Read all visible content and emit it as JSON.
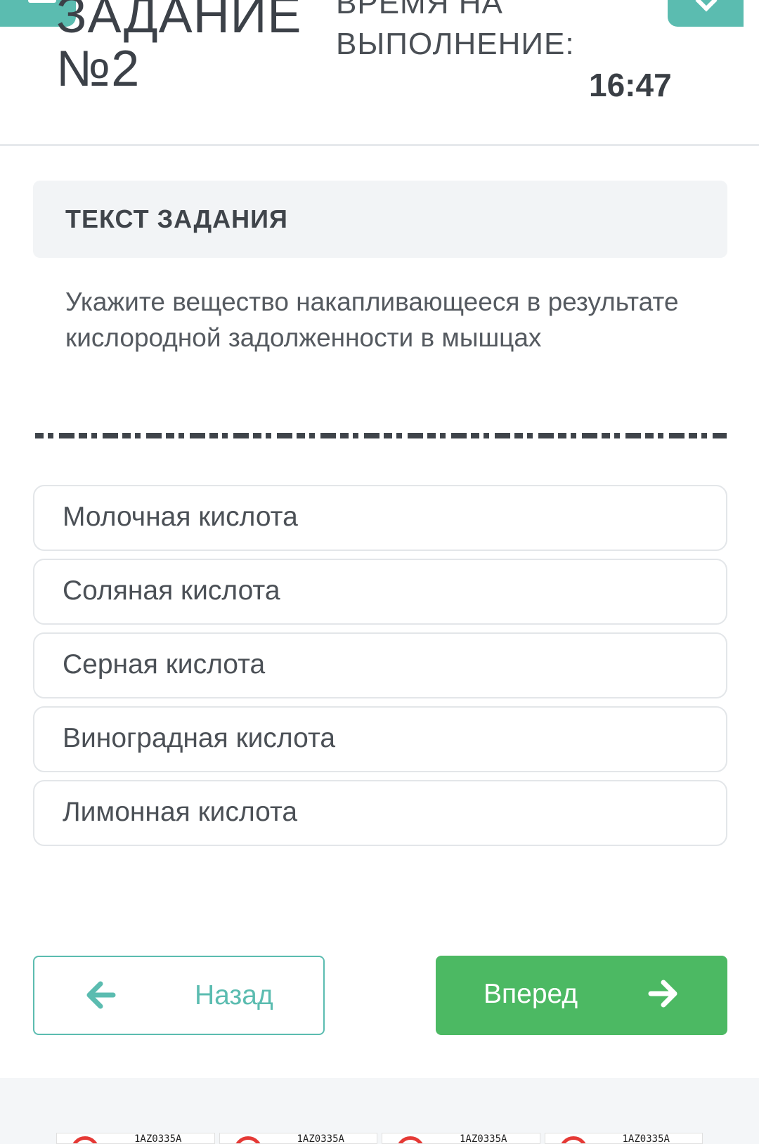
{
  "header": {
    "task_title_line1": "ЗАДАНИЕ",
    "task_title_line2": "№2",
    "time_label_line1": "ВРЕМЯ НА",
    "time_label_line2": "ВЫПОЛНЕНИЕ:",
    "timer": "16:47"
  },
  "task": {
    "section_title": "ТЕКСТ ЗАДАНИЯ",
    "question": "Укажите вещество накапливающееся в результате кислородной задолженности в мышцах"
  },
  "options": [
    "Молочная кислота",
    "Соляная кислота",
    "Серная кислота",
    "Виноградная кислота",
    "Лимонная кислота"
  ],
  "nav": {
    "back_label": "Назад",
    "next_label": "Вперед"
  },
  "ads": [
    {
      "code": "1AZ0335A"
    },
    {
      "code": "1AZ0335A"
    },
    {
      "code": "1AZ0335A"
    },
    {
      "code": "1AZ0335A"
    }
  ],
  "colors": {
    "accent_teal": "#5bbcb0",
    "next_green": "#4cb963",
    "ad_red": "#e53935"
  }
}
